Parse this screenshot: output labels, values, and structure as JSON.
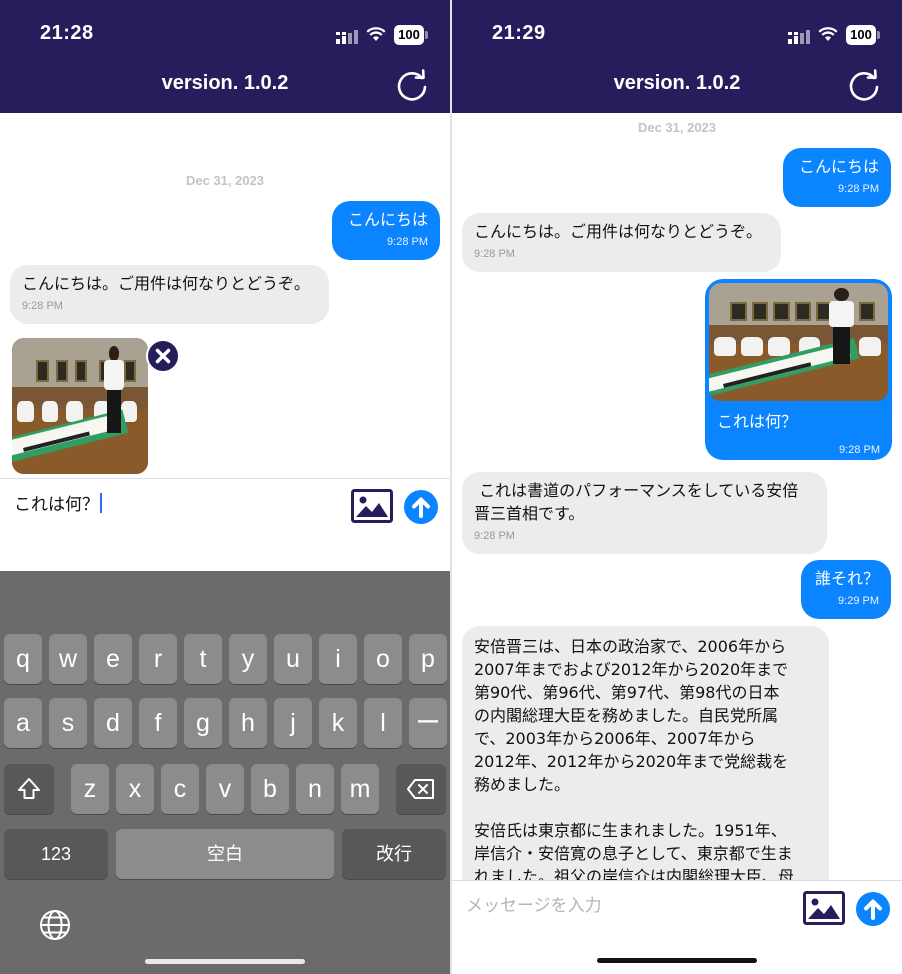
{
  "colors": {
    "header": "#261e5c",
    "sent_bubble": "#0a84ff",
    "received_bubble": "#ececec",
    "keyboard": "#6b6b6b"
  },
  "left": {
    "status": {
      "time": "21:28",
      "battery": "100"
    },
    "header": {
      "title": "version. 1.0.2",
      "refresh_icon": "refresh-icon"
    },
    "chat": {
      "date": "Dec 31, 2023",
      "messages": [
        {
          "from": "user",
          "text": "こんにちは",
          "time": "9:28 PM"
        },
        {
          "from": "bot",
          "text": "こんにちは。ご用件は何なりとどうぞ。",
          "time": "9:28 PM"
        }
      ]
    },
    "attachment": {
      "remove_icon": "close-icon"
    },
    "input": {
      "value": "これは何？"
    },
    "keyboard": {
      "row1": [
        "q",
        "w",
        "e",
        "r",
        "t",
        "y",
        "u",
        "i",
        "o",
        "p"
      ],
      "row2": [
        "a",
        "s",
        "d",
        "f",
        "g",
        "h",
        "j",
        "k",
        "l",
        "ー"
      ],
      "row3": [
        "z",
        "x",
        "c",
        "v",
        "b",
        "n",
        "m"
      ],
      "numbers": "123",
      "space": "空白",
      "return": "改行"
    }
  },
  "right": {
    "status": {
      "time": "21:29",
      "battery": "100"
    },
    "header": {
      "title": "version. 1.0.2"
    },
    "chat": {
      "date": "Dec 31, 2023",
      "messages": [
        {
          "from": "user",
          "text": "こんにちは",
          "time": "9:28 PM"
        },
        {
          "from": "bot",
          "text": "こんにちは。ご用件は何なりとどうぞ。",
          "time": "9:28 PM"
        },
        {
          "from": "user",
          "text": "これは何？",
          "time": "9:28 PM"
        },
        {
          "from": "bot",
          "text": " これは書道のパフォーマンスをしている安倍\n晋三首相です。",
          "time": "9:28 PM"
        },
        {
          "from": "user",
          "text": "誰それ？",
          "time": "9:29 PM"
        },
        {
          "from": "bot",
          "text": "安倍晋三は、日本の政治家で、2006年から\n2007年までおよび2012年から2020年まで\n第90代、第96代、第97代、第98代の日本\nの内閣総理大臣を務めました。自民党所属\nで、2003年から2006年、2007年から\n2012年、2012年から2020年まで党総裁を\n務めました。\n\n安倍氏は東京都に生まれました。1951年、\n岸信介・安倍寛の息子として、東京都で生ま\nれました。祖父の岸信介は内閣総理大臣、母"
        }
      ]
    },
    "input": {
      "placeholder": "メッセージを入力"
    }
  }
}
